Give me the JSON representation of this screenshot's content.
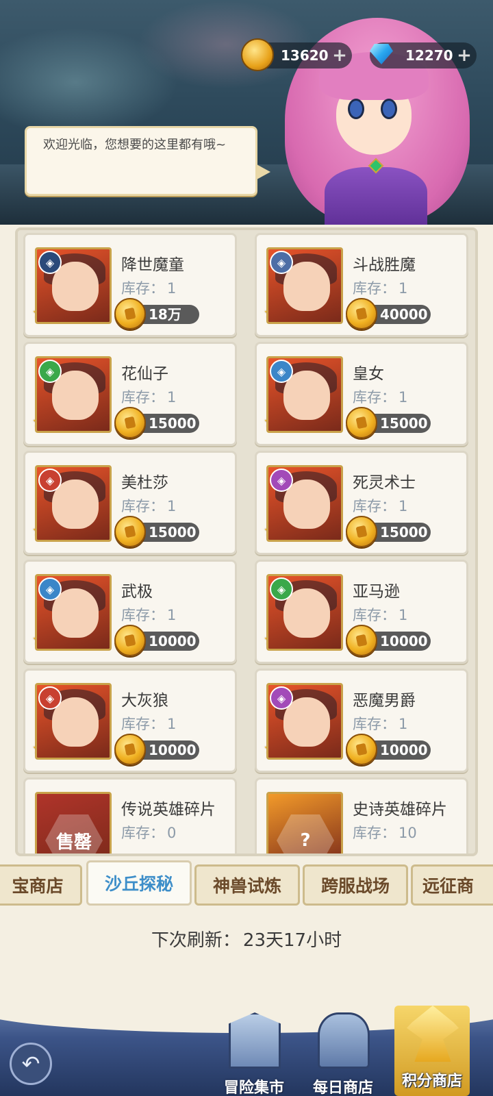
{
  "currency": {
    "coins": "13620",
    "gems": "12270",
    "plus": "+"
  },
  "npc": {
    "speech": "欢迎光临，您想要的这里都有哦~"
  },
  "items": [
    {
      "name": "降世魔童",
      "stock_label": "库存：",
      "stock": "1",
      "price": "18万",
      "stars": "★★★★★",
      "faction_icon": "dark-faction-icon",
      "faction_color": "#2b4a7a",
      "bg": "#e8542a"
    },
    {
      "name": "斗战胜魔",
      "stock_label": "库存：",
      "stock": "1",
      "price": "40000",
      "stars": "★★★★★",
      "faction_icon": "moon-faction-icon",
      "faction_color": "#4d6ea6",
      "bg": "#e8542a"
    },
    {
      "name": "花仙子",
      "stock_label": "库存：",
      "stock": "1",
      "price": "15000",
      "stars": "★★★★★",
      "faction_icon": "tree-faction-icon",
      "faction_color": "#3aa84a",
      "bg": "#e8542a"
    },
    {
      "name": "皇女",
      "stock_label": "库存：",
      "stock": "1",
      "price": "15000",
      "stars": "★★★★★",
      "faction_icon": "helmet-faction-icon",
      "faction_color": "#3b86c8",
      "bg": "#e8542a"
    },
    {
      "name": "美杜莎",
      "stock_label": "库存：",
      "stock": "1",
      "price": "15000",
      "stars": "★★★★★",
      "faction_icon": "wolf-faction-icon",
      "faction_color": "#c84030",
      "bg": "#e8542a"
    },
    {
      "name": "死灵术士",
      "stock_label": "库存：",
      "stock": "1",
      "price": "15000",
      "stars": "★★★★★",
      "faction_icon": "crescent-faction-icon",
      "faction_color": "#a24ab8",
      "bg": "#e8542a"
    },
    {
      "name": "武极",
      "stock_label": "库存：",
      "stock": "1",
      "price": "10000",
      "stars": "★★★★★",
      "faction_icon": "helmet-faction-icon",
      "faction_color": "#3b86c8",
      "bg": "#e8542a"
    },
    {
      "name": "亚马逊",
      "stock_label": "库存：",
      "stock": "1",
      "price": "10000",
      "stars": "★★★★★",
      "faction_icon": "tree-faction-icon",
      "faction_color": "#3aa84a",
      "bg": "#e8542a"
    },
    {
      "name": "大灰狼",
      "stock_label": "库存：",
      "stock": "1",
      "price": "10000",
      "stars": "★★★★★",
      "faction_icon": "wolf-faction-icon",
      "faction_color": "#c84030",
      "bg": "#e8542a"
    },
    {
      "name": "恶魔男爵",
      "stock_label": "库存：",
      "stock": "1",
      "price": "10000",
      "stars": "★★★★★",
      "faction_icon": "crescent-faction-icon",
      "faction_color": "#a24ab8",
      "bg": "#e8542a"
    },
    {
      "name": "传说英雄碎片",
      "stock_label": "库存：",
      "stock": "0",
      "price": "",
      "stars": "",
      "faction_icon": "",
      "faction_color": "",
      "bg": "#b0342a",
      "overlay": "售罄"
    },
    {
      "name": "史诗英雄碎片",
      "stock_label": "库存：",
      "stock": "10",
      "price": "",
      "stars": "",
      "faction_icon": "",
      "faction_color": "",
      "bg": "#f29a2a",
      "overlay": "?"
    }
  ],
  "tabs": [
    "宝商店",
    "沙丘探秘",
    "神兽试炼",
    "跨服战场",
    "远征商"
  ],
  "active_tab": "沙丘探秘",
  "refresh": {
    "label": "下次刷新：",
    "value": "23天17小时"
  },
  "nav": {
    "back_icon": "back-arrow-icon",
    "items": [
      {
        "label": "冒险集市",
        "icon": "market-icon"
      },
      {
        "label": "每日商店",
        "icon": "daily-shop-icon"
      },
      {
        "label": "积分商店",
        "icon": "points-scale-icon"
      }
    ],
    "active": "积分商店"
  }
}
